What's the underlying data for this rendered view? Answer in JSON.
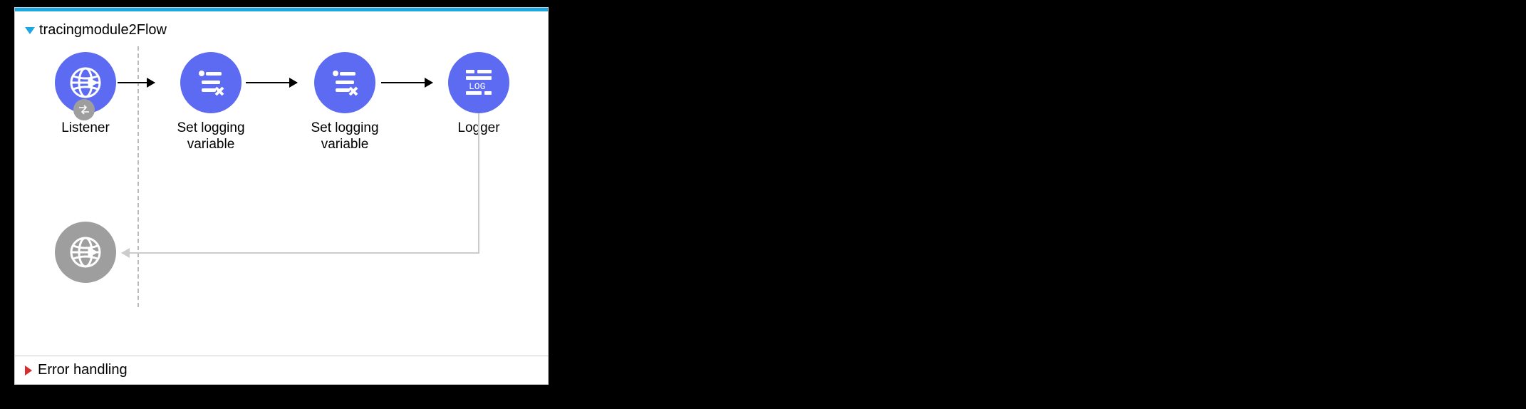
{
  "flow": {
    "title": "tracingmodule2Flow",
    "error_section_label": "Error handling",
    "nodes": [
      {
        "label": "Listener",
        "icon": "globe-arrow-icon",
        "color": "primary"
      },
      {
        "label": "Set logging variable",
        "icon": "variable-x-icon",
        "color": "primary"
      },
      {
        "label": "Set logging variable",
        "icon": "variable-x-icon",
        "color": "primary"
      },
      {
        "label": "Logger",
        "icon": "log-icon",
        "color": "primary"
      },
      {
        "label": "",
        "icon": "globe-arrow-icon",
        "color": "grey"
      }
    ]
  },
  "colors": {
    "primary": "#5c6bf2",
    "accent": "#1ba8e0",
    "grey": "#9e9e9e",
    "error": "#d32f2f"
  }
}
